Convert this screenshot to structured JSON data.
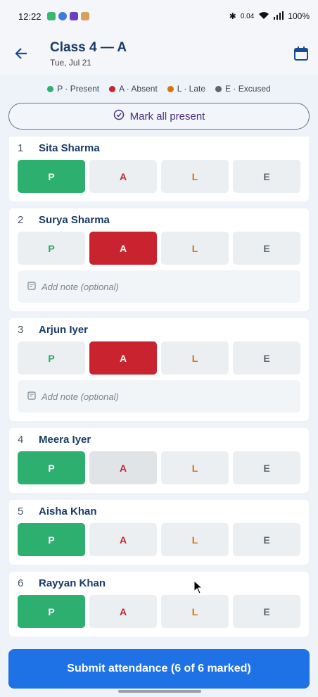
{
  "status": {
    "time": "12:22",
    "net": "0.04",
    "battery": "100%"
  },
  "header": {
    "title": "Class 4 — A",
    "date": "Tue, Jul 21"
  },
  "legend": [
    {
      "label": "P · Present",
      "color": "#2caf6f"
    },
    {
      "label": "A · Absent",
      "color": "#c8232e"
    },
    {
      "label": "L · Late",
      "color": "#d7730b"
    },
    {
      "label": "E · Excused",
      "color": "#5e6670"
    }
  ],
  "mark_all": "Mark all present",
  "buttons": {
    "p": "P",
    "a": "A",
    "l": "L",
    "e": "E"
  },
  "note_placeholder": "Add note (optional)",
  "students": [
    {
      "num": "1",
      "name": "Sita Sharma",
      "status": "P",
      "note": false
    },
    {
      "num": "2",
      "name": "Surya Sharma",
      "status": "A",
      "note": true
    },
    {
      "num": "3",
      "name": "Arjun Iyer",
      "status": "A",
      "note": true
    },
    {
      "num": "4",
      "name": "Meera Iyer",
      "status": "P",
      "note": false
    },
    {
      "num": "5",
      "name": "Aisha Khan",
      "status": "P",
      "note": false
    },
    {
      "num": "6",
      "name": "Rayyan Khan",
      "status": "P",
      "note": false
    }
  ],
  "submit": "Submit attendance (6 of 6 marked)"
}
